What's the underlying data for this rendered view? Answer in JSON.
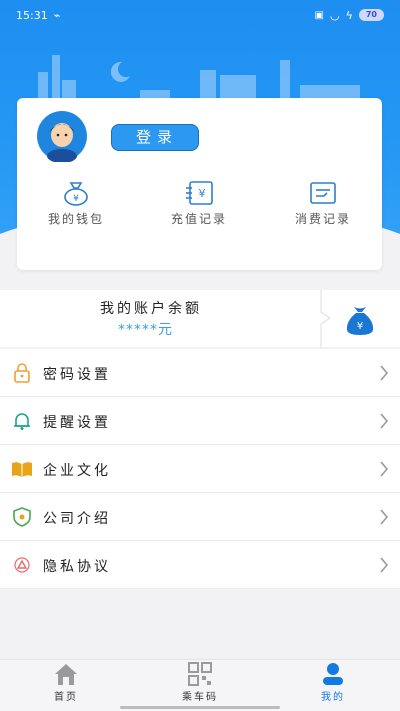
{
  "status_bar": {
    "time": "15:31",
    "battery": "70"
  },
  "profile": {
    "login_label": "登录"
  },
  "quick_actions": [
    {
      "label": "我的钱包",
      "icon": "wallet-icon"
    },
    {
      "label": "充值记录",
      "icon": "recharge-record-icon"
    },
    {
      "label": "消费记录",
      "icon": "consumption-record-icon"
    }
  ],
  "balance": {
    "title": "我的账户余额",
    "value": "*****元",
    "icon": "money-bag-icon"
  },
  "menu": [
    {
      "label": "密码设置",
      "icon": "lock-icon"
    },
    {
      "label": "提醒设置",
      "icon": "bell-icon"
    },
    {
      "label": "企业文化",
      "icon": "book-icon"
    },
    {
      "label": "公司介绍",
      "icon": "shield-icon"
    },
    {
      "label": "隐私协议",
      "icon": "privacy-icon"
    }
  ],
  "bottom_nav": [
    {
      "label": "首页",
      "icon": "home-icon",
      "active": false
    },
    {
      "label": "乘车码",
      "icon": "qr-code-icon",
      "active": false
    },
    {
      "label": "我的",
      "icon": "user-icon",
      "active": true
    }
  ],
  "colors": {
    "primary": "#2c98ef",
    "active_tab": "#1479e0",
    "balance_value": "#3b9df3"
  }
}
